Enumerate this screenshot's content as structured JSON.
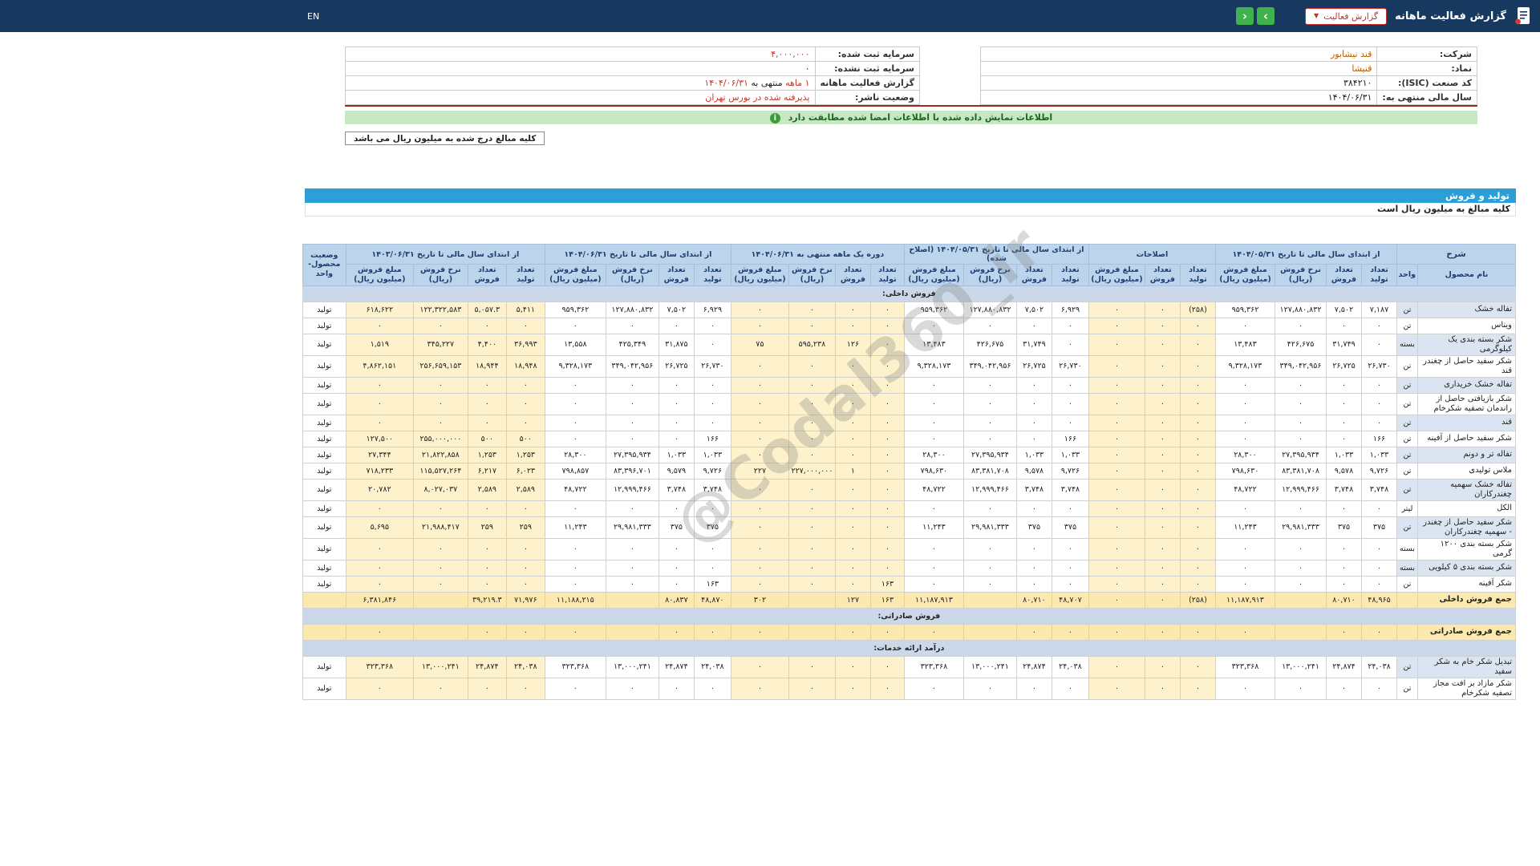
{
  "header": {
    "title": "گزارش فعالیت ماهانه",
    "report_dropdown": "گزارش فعالیت",
    "nav_forward": "›",
    "nav_back": "‹",
    "lang": "EN"
  },
  "company": {
    "right": [
      {
        "label": "شرکت:",
        "value": "قند نیشابور"
      },
      {
        "label": "نماد:",
        "value": "قنیشا"
      },
      {
        "label": "کد صنعت (ISIC):",
        "value": "۳۸۴۲۱۰"
      },
      {
        "label": "سال مالی منتهی به:",
        "value": "۱۴۰۴/۰۶/۳۱"
      }
    ],
    "left": [
      {
        "label": "سرمایه ثبت شده:",
        "value": "۴,۰۰۰,۰۰۰"
      },
      {
        "label": "سرمایه ثبت نشده:",
        "value": "۰"
      },
      {
        "label": "گزارش فعالیت ماهانه",
        "parts": [
          "۱ ماهه",
          "منتهی به",
          "۱۴۰۴/۰۶/۳۱"
        ]
      },
      {
        "label": "وضعیت ناشر:",
        "value": "پذیرفته شده در بورس تهران"
      }
    ]
  },
  "notices": {
    "signed_match": "اطلاعات نمایش داده شده با اطلاعات امضا شده مطابقت دارد",
    "amounts_note_box": "کلیه مبالغ درج شده به میلیون ریال می باشد",
    "section_title": "تولید و فروش",
    "amounts_note_row": "کلیه مبالغ به میلیون ریال است"
  },
  "watermark": "@Codal360_ir",
  "table": {
    "desc_header": "شرح",
    "col_product": "نام محصول",
    "col_unit": "واحد",
    "status_header": [
      "وضعیت",
      "محصول-واحد"
    ],
    "groups": [
      {
        "key": "g1",
        "label": "از ابتدای سال مالی تا تاریخ ۱۴۰۴/۰۵/۳۱",
        "cols": 4
      },
      {
        "key": "adj",
        "label": "اصلاحات",
        "cols": 3
      },
      {
        "key": "g3",
        "label": "از ابتدای سال مالی تا تاریخ ۱۴۰۴/۰۵/۳۱ (اصلاح شده)",
        "cols": 4
      },
      {
        "key": "g4",
        "label": "دوره یک ماهه منتهی به ۱۴۰۴/۰۶/۳۱",
        "cols": 4
      },
      {
        "key": "g5",
        "label": "از ابتدای سال مالی تا تاریخ ۱۴۰۴/۰۶/۳۱",
        "cols": 4
      },
      {
        "key": "g6",
        "label": "از ابتدای سال مالی تا تاریخ ۱۴۰۳/۰۶/۳۱",
        "cols": 4
      }
    ],
    "subcols4": [
      [
        "تعداد",
        "تولید"
      ],
      [
        "تعداد",
        "فروش"
      ],
      [
        "نرخ فروش",
        "(ریال)"
      ],
      [
        "مبلغ فروش",
        "(میلیون ریال)"
      ]
    ],
    "subcols3": [
      [
        "تعداد",
        "تولید"
      ],
      [
        "تعداد",
        "فروش"
      ],
      [
        "مبلغ فروش",
        "(میلیون ریال)"
      ]
    ],
    "rows": [
      {
        "type": "section",
        "name": "فروش داخلی:"
      },
      {
        "type": "product",
        "name": "تفاله خشک",
        "unit": "تن",
        "status": "تولید",
        "g1": [
          "۷,۱۸۷",
          "۷,۵۰۲",
          "۱۲۷,۸۸۰,۸۳۲",
          "۹۵۹,۳۶۲"
        ],
        "adj": [
          "(۲۵۸)",
          "۰",
          "۰"
        ],
        "g3": [
          "۶,۹۲۹",
          "۷,۵۰۲",
          "۱۲۷,۸۸۰,۸۳۲",
          "۹۵۹,۳۶۲"
        ],
        "g4": [
          "۰",
          "۰",
          "۰",
          "۰"
        ],
        "g5": [
          "۶,۹۲۹",
          "۷,۵۰۲",
          "۱۲۷,۸۸۰,۸۳۲",
          "۹۵۹,۳۶۲"
        ],
        "g6": [
          "۵,۴۱۱",
          "۵,۰۵۷.۳",
          "۱۲۲,۳۲۲,۵۸۳",
          "۶۱۸,۶۲۲"
        ]
      },
      {
        "type": "product",
        "name": "ویناس",
        "unit": "تن",
        "status": "تولید",
        "g1": [
          "۰",
          "۰",
          "۰",
          "۰"
        ],
        "adj": [
          "۰",
          "۰",
          "۰"
        ],
        "g3": [
          "۰",
          "۰",
          "۰",
          "۰"
        ],
        "g4": [
          "۰",
          "۰",
          "۰",
          "۰"
        ],
        "g5": [
          "۰",
          "۰",
          "۰",
          "۰"
        ],
        "g6": [
          "۰",
          "۰",
          "۰",
          "۰"
        ]
      },
      {
        "type": "product",
        "name": "شکر بسته بندی یک کیلوگرمی",
        "unit": "بسته",
        "status": "تولید",
        "g1": [
          "۰",
          "۳۱,۷۴۹",
          "۴۲۶,۶۷۵",
          "۱۳,۴۸۳"
        ],
        "adj": [
          "۰",
          "۰",
          "۰"
        ],
        "g3": [
          "۰",
          "۳۱,۷۴۹",
          "۴۲۶,۶۷۵",
          "۱۳,۴۸۳"
        ],
        "g4": [
          "۰",
          "۱۲۶",
          "۵۹۵,۲۳۸",
          "۷۵"
        ],
        "g5": [
          "۰",
          "۳۱,۸۷۵",
          "۴۲۵,۳۴۹",
          "۱۳,۵۵۸"
        ],
        "g6": [
          "۳۶,۹۹۳",
          "۴,۴۰۰",
          "۳۴۵,۲۲۷",
          "۱,۵۱۹"
        ]
      },
      {
        "type": "product",
        "name": "شکر سفید حاصل از چغندر قند",
        "unit": "تن",
        "status": "تولید",
        "g1": [
          "۲۶,۷۳۰",
          "۲۶,۷۲۵",
          "۳۴۹,۰۴۲,۹۵۶",
          "۹,۳۲۸,۱۷۳"
        ],
        "adj": [
          "۰",
          "۰",
          "۰"
        ],
        "g3": [
          "۲۶,۷۳۰",
          "۲۶,۷۲۵",
          "۳۴۹,۰۴۲,۹۵۶",
          "۹,۳۲۸,۱۷۳"
        ],
        "g4": [
          "۰",
          "۰",
          "۰",
          "۰"
        ],
        "g5": [
          "۲۶,۷۳۰",
          "۲۶,۷۲۵",
          "۳۴۹,۰۴۲,۹۵۶",
          "۹,۳۲۸,۱۷۳"
        ],
        "g6": [
          "۱۸,۹۴۸",
          "۱۸,۹۴۴",
          "۲۵۶,۶۵۹,۱۵۳",
          "۴,۸۶۲,۱۵۱"
        ]
      },
      {
        "type": "product",
        "name": "تفاله خشک خریداری",
        "unit": "تن",
        "status": "تولید",
        "g1": [
          "۰",
          "۰",
          "۰",
          "۰"
        ],
        "adj": [
          "۰",
          "۰",
          "۰"
        ],
        "g3": [
          "۰",
          "۰",
          "۰",
          "۰"
        ],
        "g4": [
          "۰",
          "۰",
          "۰",
          "۰"
        ],
        "g5": [
          "۰",
          "۰",
          "۰",
          "۰"
        ],
        "g6": [
          "۰",
          "۰",
          "۰",
          "۰"
        ]
      },
      {
        "type": "product",
        "name": "شکر بازیافتی حاصل از راندمان تصفیه شکرخام",
        "unit": "تن",
        "status": "تولید",
        "g1": [
          "۰",
          "۰",
          "۰",
          "۰"
        ],
        "adj": [
          "۰",
          "۰",
          "۰"
        ],
        "g3": [
          "۰",
          "۰",
          "۰",
          "۰"
        ],
        "g4": [
          "۰",
          "۰",
          "۰",
          "۰"
        ],
        "g5": [
          "۰",
          "۰",
          "۰",
          "۰"
        ],
        "g6": [
          "۰",
          "۰",
          "۰",
          "۰"
        ]
      },
      {
        "type": "product",
        "name": "قند",
        "unit": "تن",
        "status": "تولید",
        "g1": [
          "۰",
          "۰",
          "۰",
          "۰"
        ],
        "adj": [
          "۰",
          "۰",
          "۰"
        ],
        "g3": [
          "۰",
          "۰",
          "۰",
          "۰"
        ],
        "g4": [
          "۰",
          "۰",
          "۰",
          "۰"
        ],
        "g5": [
          "۰",
          "۰",
          "۰",
          "۰"
        ],
        "g6": [
          "۰",
          "۰",
          "۰",
          "۰"
        ]
      },
      {
        "type": "product",
        "name": "شکر سفید حاصل از آفینه",
        "unit": "تن",
        "status": "تولید",
        "g1": [
          "۱۶۶",
          "۰",
          "۰",
          "۰"
        ],
        "adj": [
          "۰",
          "۰",
          "۰"
        ],
        "g3": [
          "۱۶۶",
          "۰",
          "۰",
          "۰"
        ],
        "g4": [
          "۰",
          "۰",
          "۰",
          "۰"
        ],
        "g5": [
          "۱۶۶",
          "۰",
          "۰",
          "۰"
        ],
        "g6": [
          "۵۰۰",
          "۵۰۰",
          "۲۵۵,۰۰۰,۰۰۰",
          "۱۲۷,۵۰۰"
        ]
      },
      {
        "type": "product",
        "name": "تفاله تر و دونم",
        "unit": "تن",
        "status": "تولید",
        "g1": [
          "۱,۰۳۳",
          "۱,۰۳۳",
          "۲۷,۳۹۵,۹۳۴",
          "۲۸,۳۰۰"
        ],
        "adj": [
          "۰",
          "۰",
          "۰"
        ],
        "g3": [
          "۱,۰۳۳",
          "۱,۰۳۳",
          "۲۷,۳۹۵,۹۳۴",
          "۲۸,۳۰۰"
        ],
        "g4": [
          "۰",
          "۰",
          "۰",
          "۰"
        ],
        "g5": [
          "۱,۰۳۳",
          "۱,۰۳۳",
          "۲۷,۳۹۵,۹۳۴",
          "۲۸,۳۰۰"
        ],
        "g6": [
          "۱,۲۵۳",
          "۱,۲۵۳",
          "۲۱,۸۲۲,۸۵۸",
          "۲۷,۳۴۴"
        ]
      },
      {
        "type": "product",
        "name": "ملاس تولیدی",
        "unit": "تن",
        "status": "تولید",
        "g1": [
          "۹,۷۲۶",
          "۹,۵۷۸",
          "۸۳,۳۸۱,۷۰۸",
          "۷۹۸,۶۳۰"
        ],
        "adj": [
          "۰",
          "۰",
          "۰"
        ],
        "g3": [
          "۹,۷۲۶",
          "۹,۵۷۸",
          "۸۳,۳۸۱,۷۰۸",
          "۷۹۸,۶۳۰"
        ],
        "g4": [
          "۰",
          "۱",
          "۲۲۷,۰۰۰,۰۰۰",
          "۲۲۷"
        ],
        "g5": [
          "۹,۷۲۶",
          "۹,۵۷۹",
          "۸۳,۳۹۶,۷۰۱",
          "۷۹۸,۸۵۷"
        ],
        "g6": [
          "۶,۰۲۳",
          "۶,۲۱۷",
          "۱۱۵,۵۲۷,۲۶۴",
          "۷۱۸,۲۳۳"
        ]
      },
      {
        "type": "product",
        "name": "تفاله خشک سهمیه چغندرکاران",
        "unit": "تن",
        "status": "تولید",
        "g1": [
          "۳,۷۴۸",
          "۳,۷۴۸",
          "۱۲,۹۹۹,۴۶۶",
          "۴۸,۷۲۲"
        ],
        "adj": [
          "۰",
          "۰",
          "۰"
        ],
        "g3": [
          "۳,۷۴۸",
          "۳,۷۴۸",
          "۱۲,۹۹۹,۴۶۶",
          "۴۸,۷۲۲"
        ],
        "g4": [
          "۰",
          "۰",
          "۰",
          "۰"
        ],
        "g5": [
          "۳,۷۴۸",
          "۳,۷۴۸",
          "۱۲,۹۹۹,۴۶۶",
          "۴۸,۷۲۲"
        ],
        "g6": [
          "۲,۵۸۹",
          "۲,۵۸۹",
          "۸,۰۲۷,۰۳۷",
          "۲۰,۷۸۲"
        ]
      },
      {
        "type": "product",
        "name": "الکل",
        "unit": "لیتر",
        "status": "تولید",
        "g1": [
          "۰",
          "۰",
          "۰",
          "۰"
        ],
        "adj": [
          "۰",
          "۰",
          "۰"
        ],
        "g3": [
          "۰",
          "۰",
          "۰",
          "۰"
        ],
        "g4": [
          "۰",
          "۰",
          "۰",
          "۰"
        ],
        "g5": [
          "۰",
          "۰",
          "۰",
          "۰"
        ],
        "g6": [
          "۰",
          "۰",
          "۰",
          "۰"
        ]
      },
      {
        "type": "product",
        "name": "شکر سفید حاصل از چغندر - سهمیه چغندرکاران",
        "unit": "تن",
        "status": "تولید",
        "g1": [
          "۳۷۵",
          "۳۷۵",
          "۲۹,۹۸۱,۳۳۳",
          "۱۱,۲۴۳"
        ],
        "adj": [
          "۰",
          "۰",
          "۰"
        ],
        "g3": [
          "۳۷۵",
          "۳۷۵",
          "۲۹,۹۸۱,۳۳۳",
          "۱۱,۲۴۳"
        ],
        "g4": [
          "۰",
          "۰",
          "۰",
          "۰"
        ],
        "g5": [
          "۳۷۵",
          "۳۷۵",
          "۲۹,۹۸۱,۳۳۳",
          "۱۱,۲۴۳"
        ],
        "g6": [
          "۲۵۹",
          "۲۵۹",
          "۲۱,۹۸۸,۴۱۷",
          "۵,۶۹۵"
        ]
      },
      {
        "type": "product",
        "name": "شکر بسته بندی ۱۲۰۰ گرمی",
        "unit": "بسته",
        "status": "تولید",
        "g1": [
          "۰",
          "۰",
          "۰",
          "۰"
        ],
        "adj": [
          "۰",
          "۰",
          "۰"
        ],
        "g3": [
          "۰",
          "۰",
          "۰",
          "۰"
        ],
        "g4": [
          "۰",
          "۰",
          "۰",
          "۰"
        ],
        "g5": [
          "۰",
          "۰",
          "۰",
          "۰"
        ],
        "g6": [
          "۰",
          "۰",
          "۰",
          "۰"
        ]
      },
      {
        "type": "product",
        "name": "شکر بسته بندی ۵ کیلویی",
        "unit": "بسته",
        "status": "تولید",
        "g1": [
          "۰",
          "۰",
          "۰",
          "۰"
        ],
        "adj": [
          "۰",
          "۰",
          "۰"
        ],
        "g3": [
          "۰",
          "۰",
          "۰",
          "۰"
        ],
        "g4": [
          "۰",
          "۰",
          "۰",
          "۰"
        ],
        "g5": [
          "۰",
          "۰",
          "۰",
          "۰"
        ],
        "g6": [
          "۰",
          "۰",
          "۰",
          "۰"
        ]
      },
      {
        "type": "product",
        "name": "شکر آفینه",
        "unit": "تن",
        "status": "تولید",
        "g1": [
          "۰",
          "۰",
          "۰",
          "۰"
        ],
        "adj": [
          "۰",
          "۰",
          "۰"
        ],
        "g3": [
          "۰",
          "۰",
          "۰",
          "۰"
        ],
        "g4": [
          "۱۶۳",
          "۰",
          "۰",
          "۰"
        ],
        "g5": [
          "۱۶۳",
          "۰",
          "۰",
          "۰"
        ],
        "g6": [
          "۰",
          "۰",
          "۰",
          "۰"
        ]
      },
      {
        "type": "total",
        "name": "جمع فروش داخلی",
        "unit": "",
        "status": "",
        "g1": [
          "۴۸,۹۶۵",
          "۸۰,۷۱۰",
          "",
          "۱۱,۱۸۷,۹۱۳"
        ],
        "adj": [
          "(۲۵۸)",
          "۰",
          "۰"
        ],
        "g3": [
          "۴۸,۷۰۷",
          "۸۰,۷۱۰",
          "",
          "۱۱,۱۸۷,۹۱۳"
        ],
        "g4": [
          "۱۶۳",
          "۱۲۷",
          "",
          "۳۰۲"
        ],
        "g5": [
          "۴۸,۸۷۰",
          "۸۰,۸۳۷",
          "",
          "۱۱,۱۸۸,۲۱۵"
        ],
        "g6": [
          "۷۱,۹۷۶",
          "۳۹,۲۱۹.۳",
          "",
          "۶,۳۸۱,۸۴۶"
        ]
      },
      {
        "type": "section",
        "name": "فروش صادراتی:"
      },
      {
        "type": "total",
        "name": "جمع فروش صادراتی",
        "unit": "",
        "status": "",
        "g1": [
          "۰",
          "۰",
          "",
          "۰"
        ],
        "adj": [
          "۰",
          "۰",
          "۰"
        ],
        "g3": [
          "۰",
          "۰",
          "",
          "۰"
        ],
        "g4": [
          "۰",
          "۰",
          "",
          "۰"
        ],
        "g5": [
          "۰",
          "۰",
          "",
          "۰"
        ],
        "g6": [
          "۰",
          "۰",
          "",
          "۰"
        ]
      },
      {
        "type": "section",
        "name": "درآمد ارائه خدمات:"
      },
      {
        "type": "product",
        "name": "تبدیل شکر خام به شکر سفید",
        "unit": "تن",
        "status": "تولید",
        "g1": [
          "۲۴,۰۳۸",
          "۲۴,۸۷۴",
          "۱۳,۰۰۰,۲۴۱",
          "۳۲۳,۳۶۸"
        ],
        "adj": [
          "۰",
          "۰",
          "۰"
        ],
        "g3": [
          "۲۴,۰۳۸",
          "۲۴,۸۷۴",
          "۱۳,۰۰۰,۲۴۱",
          "۳۲۳,۳۶۸"
        ],
        "g4": [
          "۰",
          "۰",
          "۰",
          "۰"
        ],
        "g5": [
          "۲۴,۰۳۸",
          "۲۴,۸۷۴",
          "۱۳,۰۰۰,۲۴۱",
          "۳۲۳,۳۶۸"
        ],
        "g6": [
          "۲۴,۰۳۸",
          "۲۴,۸۷۴",
          "۱۳,۰۰۰,۲۴۱",
          "۳۲۳,۳۶۸"
        ]
      },
      {
        "type": "product",
        "name": "شکر مازاد بر افت مجاز تصفیه شکرخام",
        "unit": "تن",
        "status": "تولید",
        "g1": [
          "۰",
          "۰",
          "۰",
          "۰"
        ],
        "adj": [
          "۰",
          "۰",
          "۰"
        ],
        "g3": [
          "۰",
          "۰",
          "۰",
          "۰"
        ],
        "g4": [
          "۰",
          "۰",
          "۰",
          "۰"
        ],
        "g5": [
          "۰",
          "۰",
          "۰",
          "۰"
        ],
        "g6": [
          "۰",
          "۰",
          "۰",
          "۰"
        ]
      }
    ]
  }
}
